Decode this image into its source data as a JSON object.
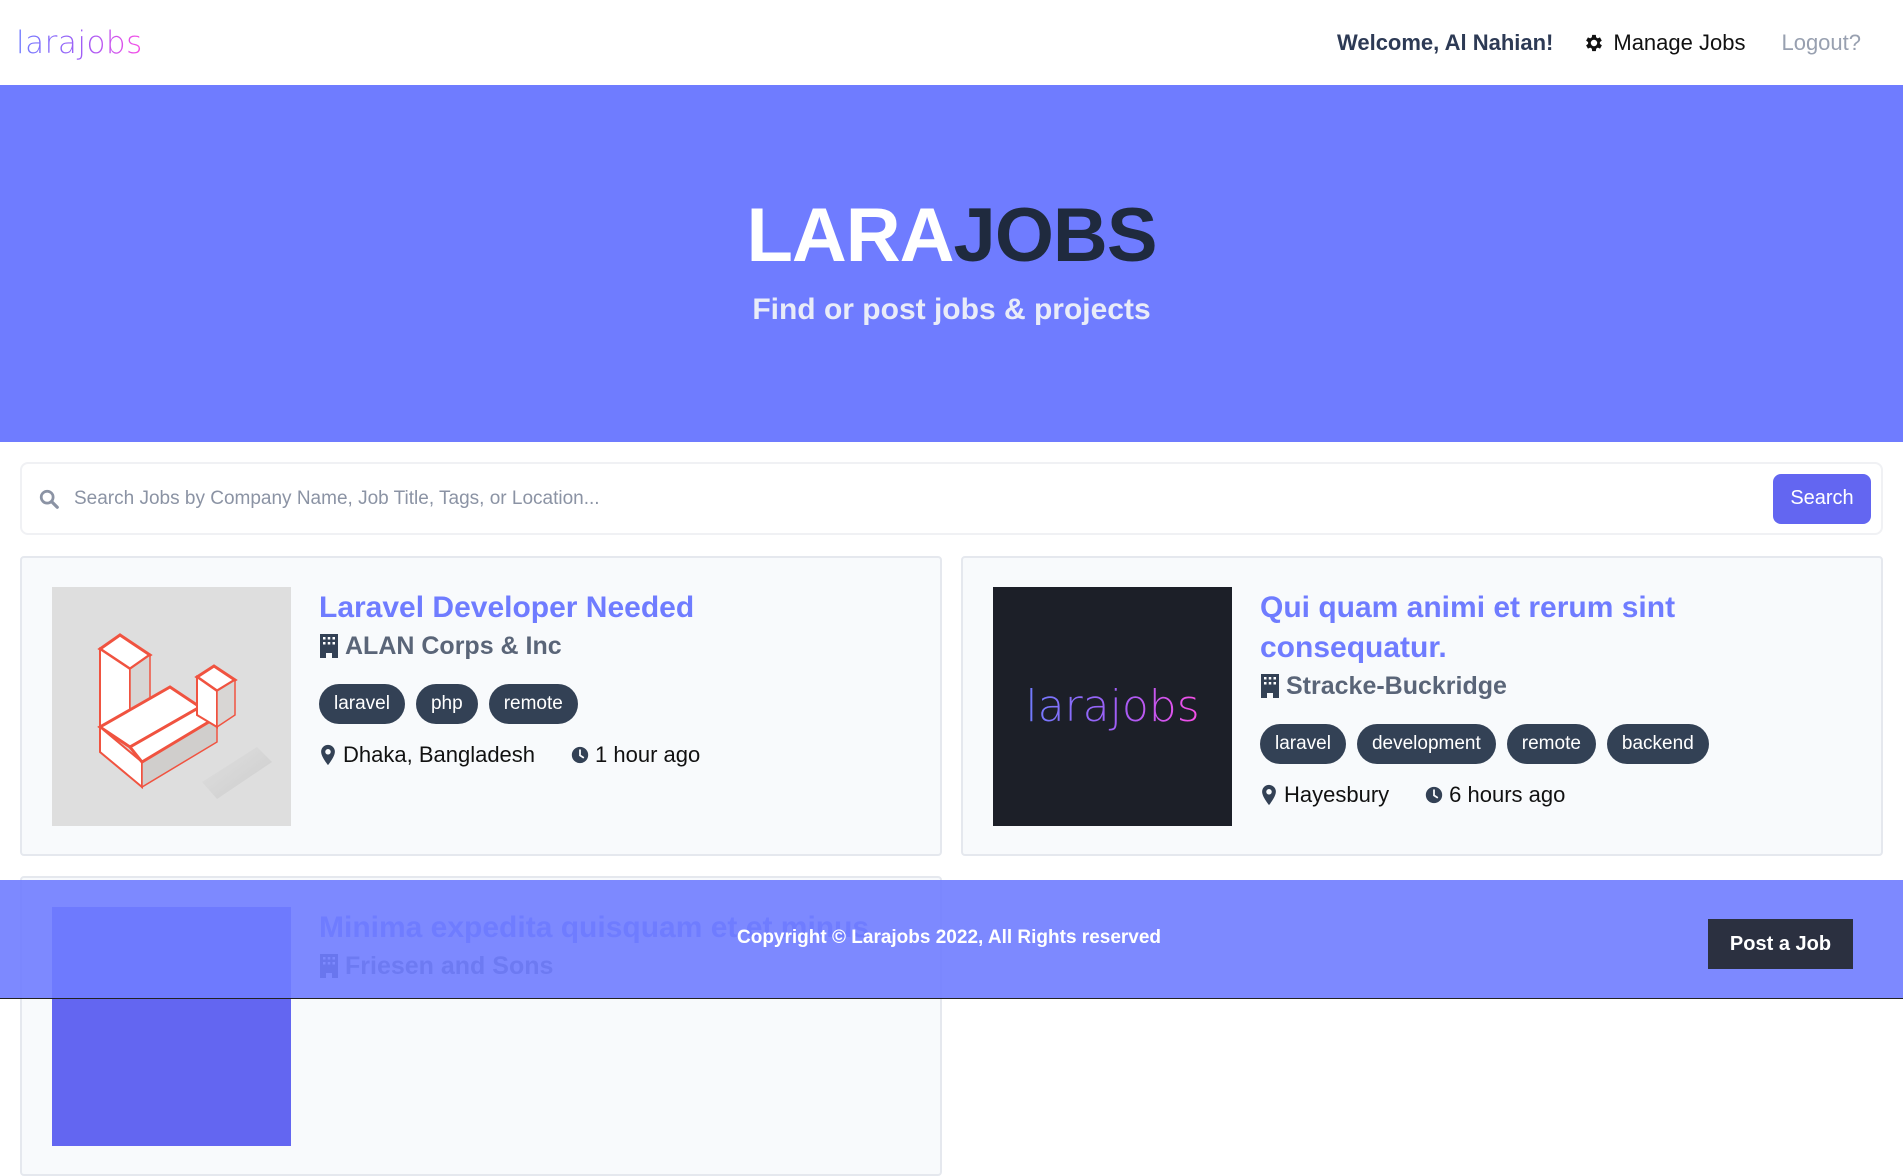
{
  "nav": {
    "logo": "larajobs",
    "welcome": "Welcome, Al Nahian!",
    "manage_jobs": "Manage Jobs",
    "logout": "Logout?"
  },
  "hero": {
    "title_part1": "LARA",
    "title_part2": "JOBS",
    "subtitle": "Find or post jobs & projects"
  },
  "search": {
    "placeholder": "Search Jobs by Company Name, Job Title, Tags, or Location...",
    "value": "",
    "button_label": "Search"
  },
  "jobs": [
    {
      "title": "Laravel Developer Needed",
      "company": "ALAN Corps & Inc",
      "tags": [
        "laravel",
        "php",
        "remote"
      ],
      "location": "Dhaka, Bangladesh",
      "posted": "1 hour ago",
      "logo": "laravel-logo"
    },
    {
      "title": "Qui quam animi et rerum sint consequatur.",
      "company": "Stracke-Buckridge",
      "tags": [
        "laravel",
        "development",
        "remote",
        "backend"
      ],
      "location": "Hayesbury",
      "posted": "6 hours ago",
      "logo_text": "larajobs"
    },
    {
      "title": "Minima expedita quisquam et et minus",
      "company": "Friesen and Sons"
    }
  ],
  "footer": {
    "copyright": "Copyright © Larajobs 2022, All Rights reserved",
    "post_job": "Post a Job"
  },
  "colors": {
    "brand": "#6f7cff",
    "primary_button": "#6366f1",
    "tag_bg": "#334155",
    "dark": "#1f2a3e"
  }
}
